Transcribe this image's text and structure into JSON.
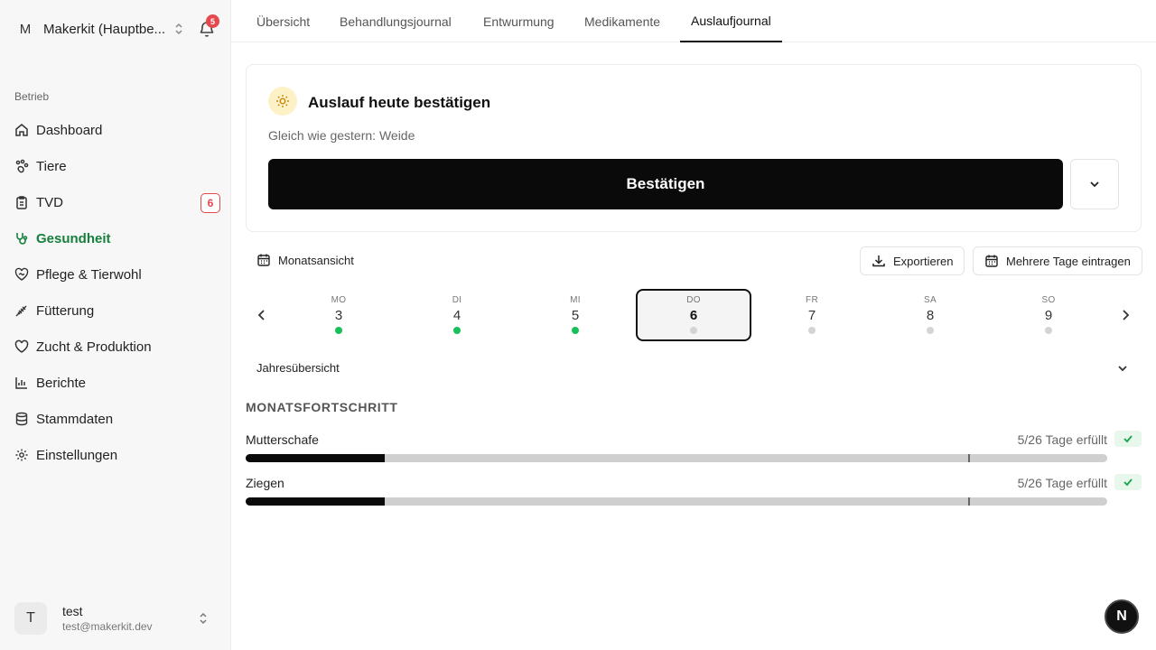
{
  "org": {
    "initial": "M",
    "name": "Makerkit (Hauptbe...",
    "notifications": "5"
  },
  "sidebar": {
    "section": "Betrieb",
    "items": [
      {
        "label": "Dashboard",
        "icon": "home-icon"
      },
      {
        "label": "Tiere",
        "icon": "paw-icon"
      },
      {
        "label": "TVD",
        "icon": "clipboard-icon",
        "badge": "6"
      },
      {
        "label": "Gesundheit",
        "icon": "stethoscope-icon",
        "active": true
      },
      {
        "label": "Pflege & Tierwohl",
        "icon": "heart-handshake-icon"
      },
      {
        "label": "Fütterung",
        "icon": "wheat-icon"
      },
      {
        "label": "Zucht & Produktion",
        "icon": "heart-icon"
      },
      {
        "label": "Berichte",
        "icon": "bar-chart-icon"
      },
      {
        "label": "Stammdaten",
        "icon": "database-icon"
      },
      {
        "label": "Einstellungen",
        "icon": "gear-icon"
      }
    ]
  },
  "user": {
    "initial": "T",
    "name": "test",
    "email": "test@makerkit.dev"
  },
  "tabs": [
    "Übersicht",
    "Behandlungsjournal",
    "Entwurmung",
    "Medikamente",
    "Auslaufjournal"
  ],
  "active_tab": "Auslaufjournal",
  "card": {
    "title": "Auslauf heute bestätigen",
    "subtitle": "Gleich wie gestern: Weide",
    "confirm_label": "Bestätigen"
  },
  "toolbar": {
    "month_view": "Monatsansicht",
    "export": "Exportieren",
    "multi_days": "Mehrere Tage eintragen"
  },
  "week": [
    {
      "dow": "MO",
      "day": "3",
      "done": true
    },
    {
      "dow": "DI",
      "day": "4",
      "done": true
    },
    {
      "dow": "MI",
      "day": "5",
      "done": true
    },
    {
      "dow": "DO",
      "day": "6",
      "done": false,
      "selected": true
    },
    {
      "dow": "FR",
      "day": "7",
      "done": false
    },
    {
      "dow": "SA",
      "day": "8",
      "done": false
    },
    {
      "dow": "SO",
      "day": "9",
      "done": false
    }
  ],
  "year_overview": "Jahresübersicht",
  "progress": {
    "title": "MONATSFORTSCHRITT",
    "rows": [
      {
        "label": "Mutterschafe",
        "status": "5/26 Tage erfüllt",
        "done": 5,
        "target": 26,
        "month_days": 31
      },
      {
        "label": "Ziegen",
        "status": "5/26 Tage erfüllt",
        "done": 5,
        "target": 26,
        "month_days": 31
      }
    ]
  },
  "fab": "N",
  "colors": {
    "accent_green": "#15803d",
    "dot_green": "#16c15a",
    "badge_red": "#e5484d"
  }
}
